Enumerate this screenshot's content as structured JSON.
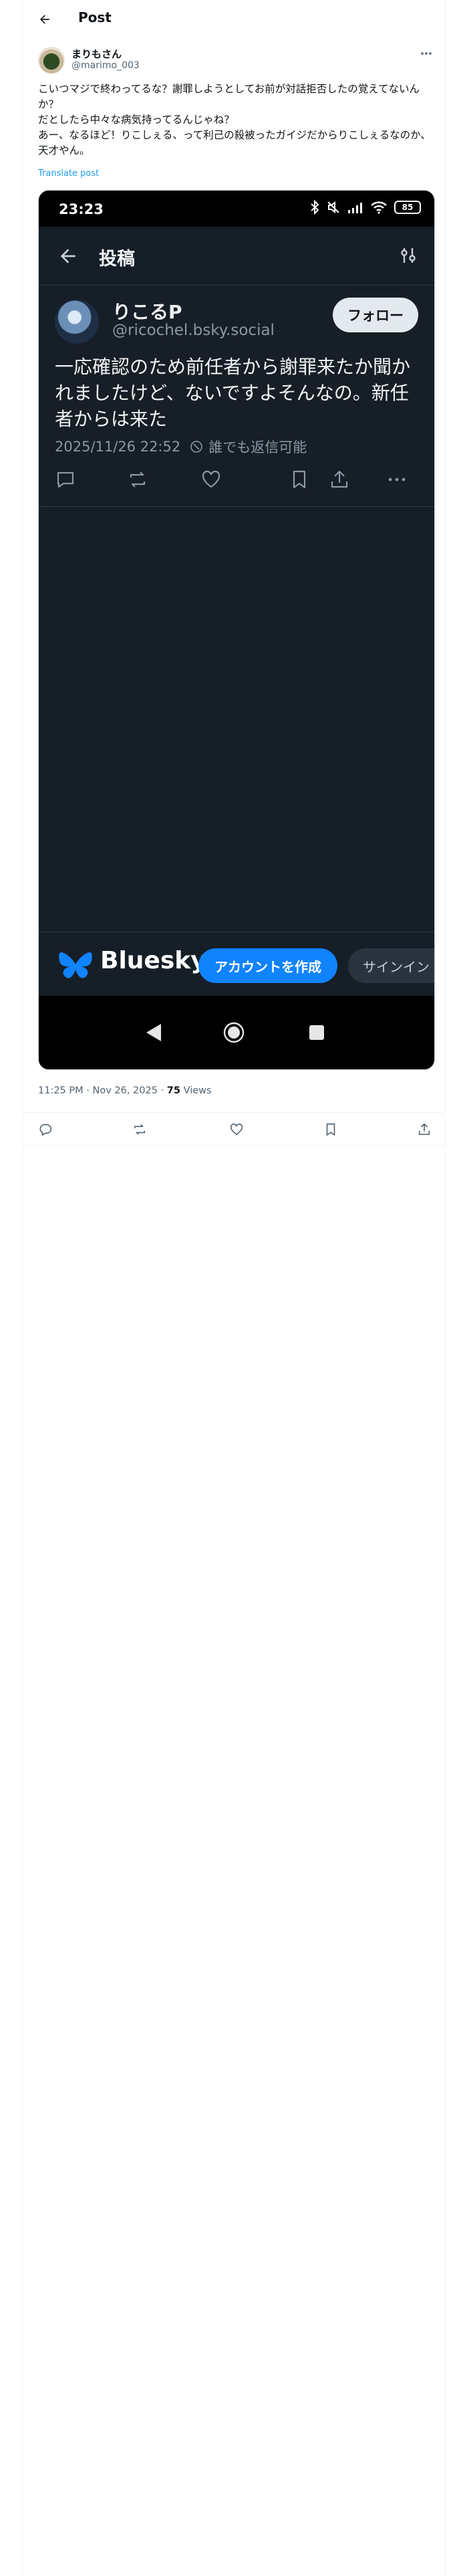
{
  "header": {
    "title": "Post"
  },
  "tweet": {
    "author_name": "まりもさん",
    "author_handle": "@marimo_003",
    "text": "こいつマジで終わってるな？謝罪しようとしてお前が対話拒否したの覚えてないんか？\nだとしたら中々な病気持ってるんじゃね？\nあー、なるほど！りこしぇる、って利己の殺被ったガイジだからりこしぇるなのか、天才やん。",
    "translate_label": "Translate post",
    "timestamp": "11:25 PM · Nov 26, 2025",
    "separator": " · ",
    "views_count": "75",
    "views_label": " Views"
  },
  "screenshot": {
    "status_time": "23:23",
    "battery": "85",
    "app_title": "投稿",
    "post": {
      "name": "りこるP",
      "handle": "@ricochel.bsky.social",
      "follow_label": "フォロー",
      "text": "一応確認のため前任者から謝罪来たか聞かれましたけど、ないですよそんなの。新任者からは来た",
      "date": "2025/11/26 22:52",
      "reply_setting": "誰でも返信可能"
    },
    "promo": {
      "brand": "Bluesky",
      "create_account": "アカウントを作成",
      "sign_in": "サインイン"
    }
  },
  "colors": {
    "accent": "#1d9bf0",
    "bluesky_blue": "#1083fe",
    "dark_bg": "#161e27"
  }
}
